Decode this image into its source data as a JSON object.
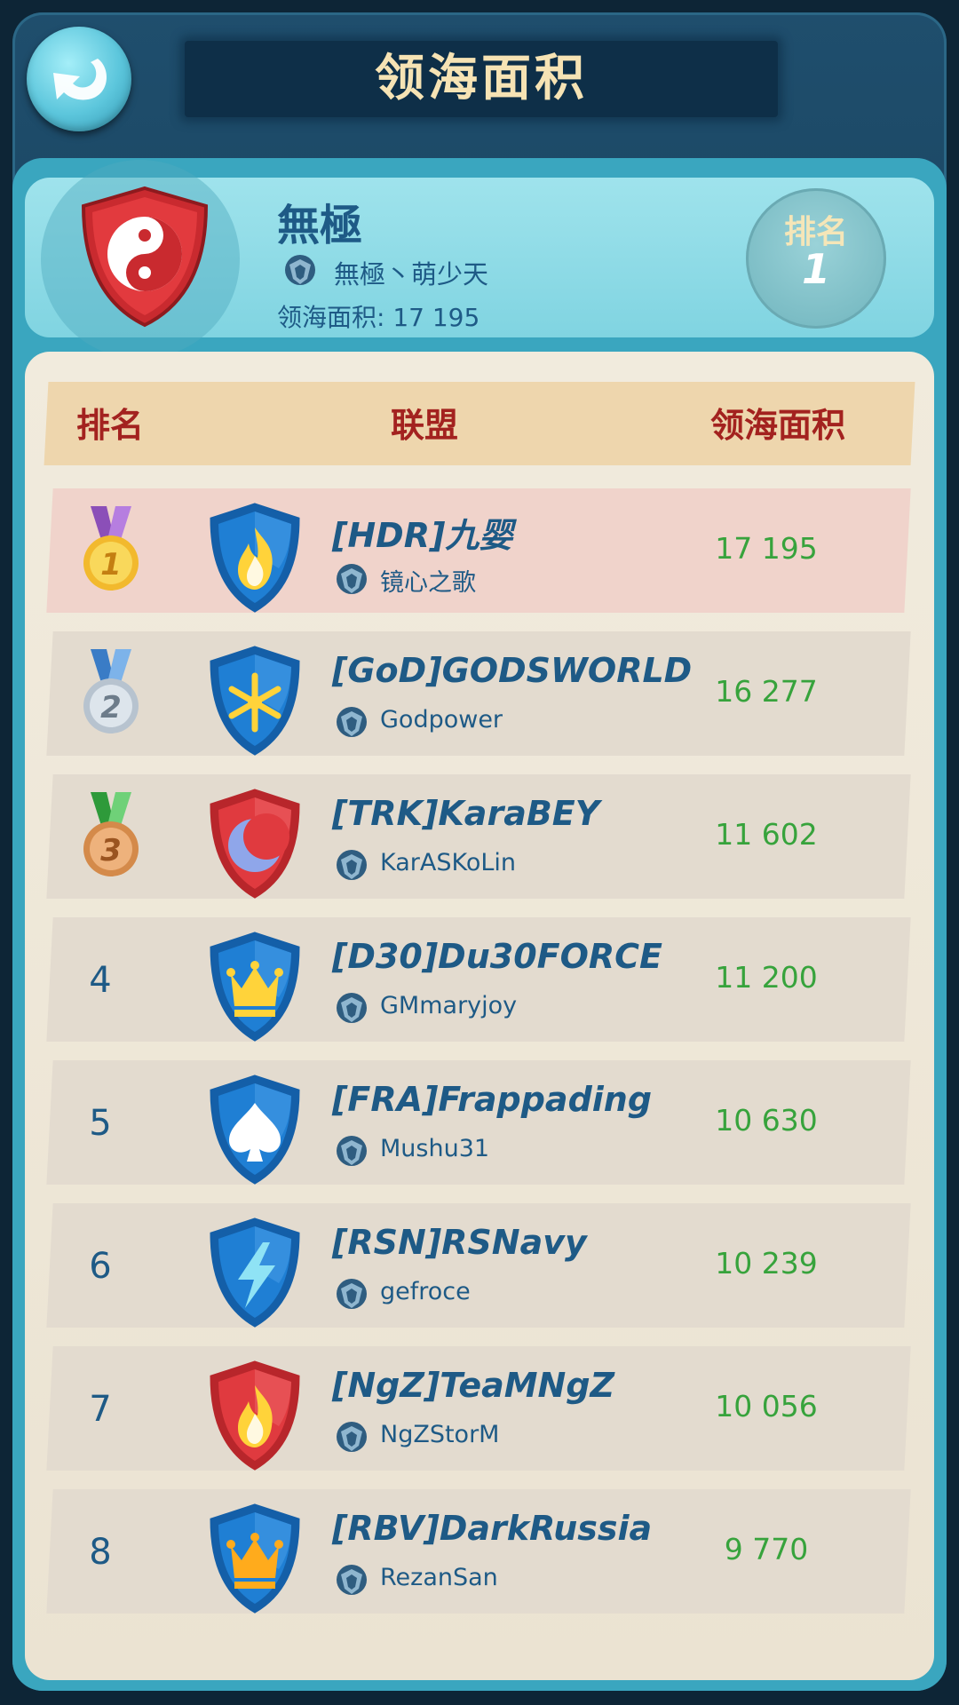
{
  "header": {
    "title": "领海面积"
  },
  "my_alliance": {
    "name": "無極",
    "leader": "無極丶萌少天",
    "area_label": "领海面积: 17 195",
    "rank_label": "排名",
    "rank_value": "1",
    "crest_icon": "yin-yang-shield-icon"
  },
  "table": {
    "headers": {
      "rank": "排名",
      "alliance": "联盟",
      "area": "领海面积"
    },
    "rows": [
      {
        "rank": "1",
        "medal": "gold-medal-icon",
        "crest": "fire-shield-blue",
        "alliance": "[HDR]九婴",
        "leader": "镜心之歌",
        "area": "17 195"
      },
      {
        "rank": "2",
        "medal": "silver-medal-icon",
        "crest": "snowflake-shield-blue",
        "alliance": "[GoD]GODSWORLD",
        "leader": "Godpower",
        "area": "16 277"
      },
      {
        "rank": "3",
        "medal": "bronze-medal-icon",
        "crest": "moon-shield-red",
        "alliance": "[TRK]KaraBEY",
        "leader": "KarASKoLin",
        "area": "11 602"
      },
      {
        "rank": "4",
        "medal": "",
        "crest": "crown-shield-blue",
        "alliance": "[D30]Du30FORCE",
        "leader": "GMmaryjoy",
        "area": "11 200"
      },
      {
        "rank": "5",
        "medal": "",
        "crest": "spade-shield-blue",
        "alliance": "[FRA]Frappading",
        "leader": "Mushu31",
        "area": "10 630"
      },
      {
        "rank": "6",
        "medal": "",
        "crest": "lightning-shield-blue",
        "alliance": "[RSN]RSNavy",
        "leader": "gefroce",
        "area": "10 239"
      },
      {
        "rank": "7",
        "medal": "",
        "crest": "fire-shield-red",
        "alliance": "[NgZ]TeaMNgZ",
        "leader": "NgZStorM",
        "area": "10 056"
      },
      {
        "rank": "8",
        "medal": "",
        "crest": "crown-shield-blue-orange",
        "alliance": "[RBV]DarkRussia",
        "leader": "RezanSan",
        "area": "9 770"
      }
    ]
  },
  "colors": {
    "name_blue": "#1e5a86",
    "area_green": "#37a33c",
    "header_red": "#a3221f",
    "title_cream": "#f6e3b4"
  }
}
